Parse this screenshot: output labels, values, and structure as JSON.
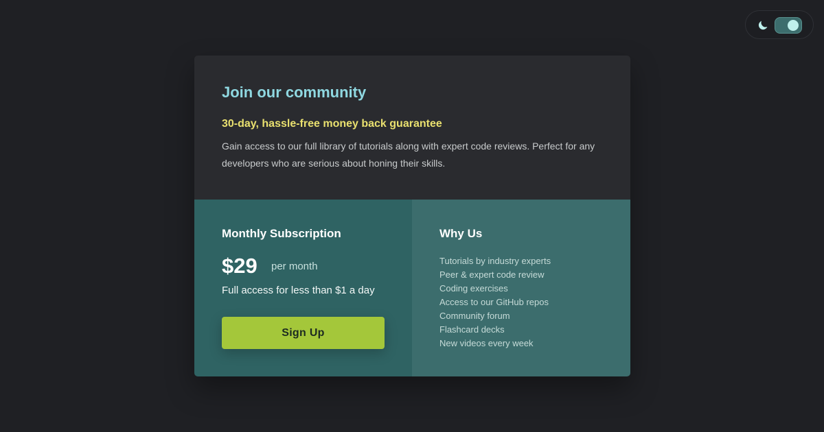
{
  "theme_toggle": {
    "icon": "moon-icon",
    "state": "dark",
    "track_color": "#3c6d6d",
    "knob_color": "#bff0ec"
  },
  "card": {
    "title": "Join our community",
    "guarantee": "30-day, hassle-free money back guarantee",
    "description": "Gain access to our full library of tutorials along with expert code reviews. Perfect for any developers who are serious about honing their skills.",
    "subscription": {
      "heading": "Monthly Subscription",
      "price": "$29",
      "period": "per month",
      "note": "Full access for less than $1 a day",
      "cta_label": "Sign Up"
    },
    "why_us": {
      "heading": "Why Us",
      "items": [
        "Tutorials by industry experts",
        "Peer & expert code review",
        "Coding exercises",
        "Access to our GitHub repos",
        "Community forum",
        "Flashcard decks",
        "New videos every week"
      ]
    }
  },
  "colors": {
    "page_background": "#1f2024",
    "card_top": "#2a2b2f",
    "subscription_panel": "#2f6363",
    "why_panel": "#3c6d6d",
    "title": "#8fd8e1",
    "guarantee": "#e9e06f",
    "cta": "#a4c73a"
  }
}
